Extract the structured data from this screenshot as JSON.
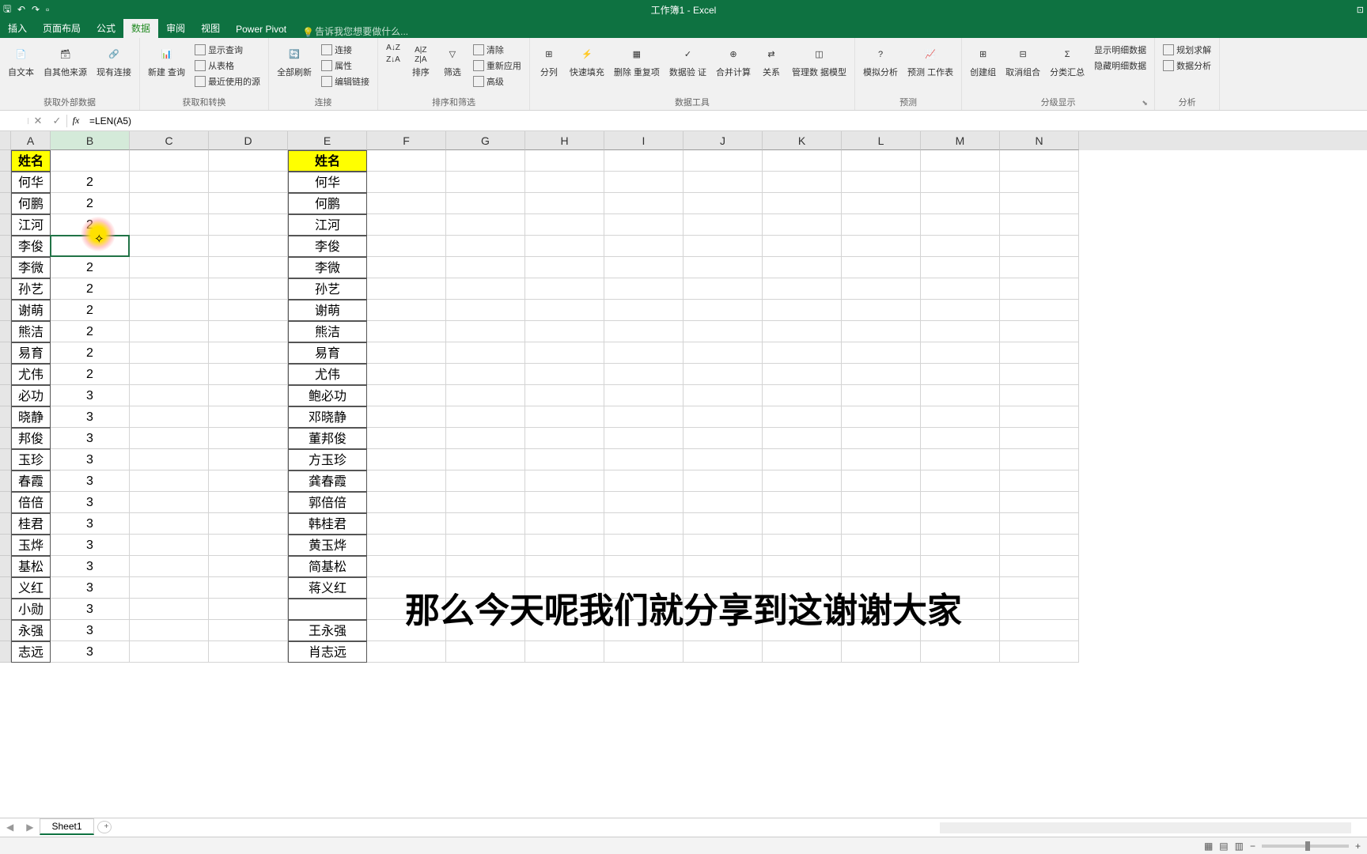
{
  "title": "工作簿1 - Excel",
  "tabs": {
    "insert": "插入",
    "layout": "页面布局",
    "formula": "公式",
    "data": "数据",
    "review": "审阅",
    "view": "视图",
    "powerpivot": "Power Pivot"
  },
  "tellme": "告诉我您想要做什么...",
  "ribbon": {
    "g1_label": "获取外部数据",
    "g1_btns": {
      "fromtext": "自文本",
      "fromother": "自其他来源",
      "existing": "现有连接"
    },
    "g2_label": "获取和转换",
    "g2_main": "新建\n查询",
    "g2_items": {
      "showq": "显示查询",
      "fromtable": "从表格",
      "recent": "最近使用的源"
    },
    "g3_label": "连接",
    "g3_main": "全部刷新",
    "g3_items": {
      "conn": "连接",
      "prop": "属性",
      "edit": "编辑链接"
    },
    "g4_label": "排序和筛选",
    "g4_items": {
      "sort": "排序",
      "filter": "筛选",
      "clear": "清除",
      "reapply": "重新应用",
      "adv": "高级"
    },
    "g5_label": "数据工具",
    "g5_items": {
      "split": "分列",
      "flash": "快速填充",
      "dedup": "删除\n重复项",
      "valid": "数据验\n证",
      "consol": "合并计算",
      "rel": "关系",
      "model": "管理数\n据模型"
    },
    "g6_label": "预测",
    "g6_items": {
      "whatif": "模拟分析",
      "forecast": "预测\n工作表"
    },
    "g7_label": "分级显示",
    "g7_items": {
      "group": "创建组",
      "ungroup": "取消组合",
      "subtotal": "分类汇总",
      "showdetail": "显示明细数据",
      "hidedetail": "隐藏明细数据"
    },
    "g8_label": "分析",
    "g8_items": {
      "solver": "规划求解",
      "analysis": "数据分析"
    }
  },
  "formula": "=LEN(A5)",
  "cols": [
    "A",
    "B",
    "C",
    "D",
    "E",
    "F",
    "G",
    "H",
    "I",
    "J",
    "K",
    "L",
    "M",
    "N"
  ],
  "header_a": "姓名",
  "header_e": "姓名",
  "data_rows": [
    {
      "a": "何华",
      "b": "2",
      "e": "何华"
    },
    {
      "a": "何鹏",
      "b": "2",
      "e": "何鹏"
    },
    {
      "a": "江河",
      "b": "2",
      "e": "江河"
    },
    {
      "a": "李俊",
      "b": "",
      "e": "李俊"
    },
    {
      "a": "李微",
      "b": "2",
      "e": "李微"
    },
    {
      "a": "孙艺",
      "b": "2",
      "e": "孙艺"
    },
    {
      "a": "谢萌",
      "b": "2",
      "e": "谢萌"
    },
    {
      "a": "熊洁",
      "b": "2",
      "e": "熊洁"
    },
    {
      "a": "易育",
      "b": "2",
      "e": "易育"
    },
    {
      "a": "尤伟",
      "b": "2",
      "e": "尤伟"
    },
    {
      "a": "必功",
      "b": "3",
      "e": "鲍必功"
    },
    {
      "a": "晓静",
      "b": "3",
      "e": "邓晓静"
    },
    {
      "a": "邦俊",
      "b": "3",
      "e": "董邦俊"
    },
    {
      "a": "玉珍",
      "b": "3",
      "e": "方玉珍"
    },
    {
      "a": "春霞",
      "b": "3",
      "e": "龚春霞"
    },
    {
      "a": "倍倍",
      "b": "3",
      "e": "郭倍倍"
    },
    {
      "a": "桂君",
      "b": "3",
      "e": "韩桂君"
    },
    {
      "a": "玉烨",
      "b": "3",
      "e": "黄玉烨"
    },
    {
      "a": "基松",
      "b": "3",
      "e": "简基松"
    },
    {
      "a": "义红",
      "b": "3",
      "e": "蒋义红"
    },
    {
      "a": "小勋",
      "b": "3",
      "e": ""
    },
    {
      "a": "永强",
      "b": "3",
      "e": "王永强"
    },
    {
      "a": "志远",
      "b": "3",
      "e": "肖志远"
    }
  ],
  "sheet": "Sheet1",
  "subtitle": "那么今天呢我们就分享到这谢谢大家"
}
